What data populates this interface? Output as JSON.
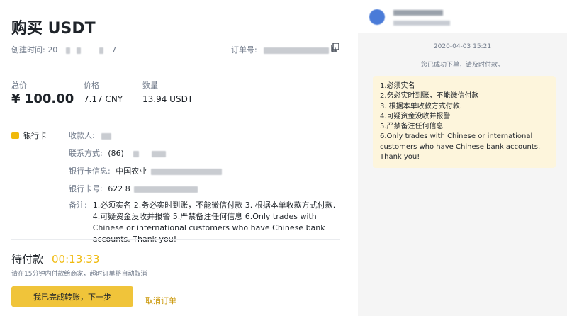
{
  "order": {
    "title": "购买 USDT",
    "created_label": "创建时间:",
    "created_value_start": "20",
    "created_value_end": "7",
    "order_no_label": "订单号:",
    "order_no_end": "0"
  },
  "amounts": {
    "total_label": "总价",
    "total_value": "¥ 100.00",
    "price_label": "价格",
    "price_value": "7.17 CNY",
    "quantity_label": "数量",
    "quantity_value": "13.94 USDT"
  },
  "payment": {
    "method": "银行卡",
    "payee_label": "收款人:",
    "contact_label": "联系方式:",
    "contact_value_start": "(86)",
    "bank_info_label": "银行卡信息:",
    "bank_info_value_start": "中国农业",
    "card_no_label": "银行卡号:",
    "card_no_value_start": "622 8",
    "remark_label": "备注:",
    "remark_text": "1.必须实名 2.务必实时到账，不能微信付款 3. 根据本单收款方式付款. 4.可疑资金没收并报警 5.严禁备注任何信息 6.Only trades with Chinese or international customers who have Chinese bank accounts. Thank you!"
  },
  "status": {
    "pending_label": "待付款",
    "countdown": "00:13:33",
    "hint": "请在15分钟内付款给商家，超时订单将自动取消"
  },
  "actions": {
    "confirm_label": "我已完成转账，下一步",
    "cancel_label": "取消订单"
  },
  "chat": {
    "timestamp": "2020-04-03 15:21",
    "system_message": "您已成功下单，请及时付款。",
    "message_lines": [
      "1.必须实名",
      "2.务必实时到账，不能微信付款",
      "3. 根据本单收款方式付款.",
      "4.可疑资金没收并报警",
      "5.严禁备注任何信息",
      "6.Only trades with Chinese or international customers who have Chinese bank accounts. Thank you!"
    ]
  },
  "colors": {
    "accent": "#f0b90b",
    "button": "#f0c43a",
    "cancel_link": "#c99400",
    "bubble": "#fdf5dc",
    "chat_bg": "#f5f5f5"
  }
}
